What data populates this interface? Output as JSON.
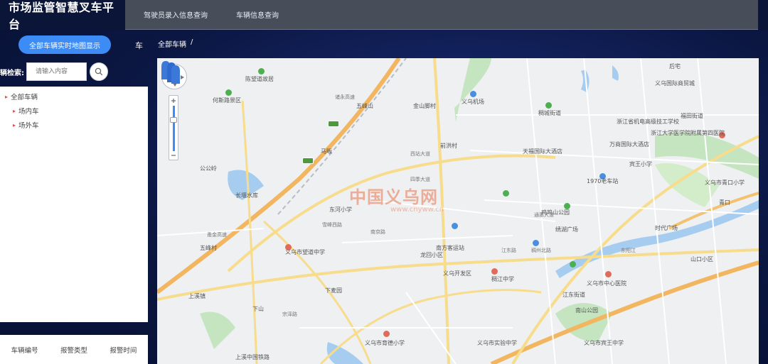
{
  "app": {
    "title": "市场监管智慧叉车平台"
  },
  "nav": {
    "items": [
      "驾驶员录入信息查询",
      "车辆信息查询"
    ]
  },
  "left": {
    "realtime_button": "全部车辆实时地图显示",
    "car_label": "车",
    "search": {
      "label": "辆检索:",
      "placeholder": "请输入内容"
    },
    "tree": {
      "root": "全部车辆",
      "children": [
        "场内车",
        "场外车"
      ]
    },
    "table_headers": [
      "车辆编号",
      "报警类型",
      "报警时间"
    ]
  },
  "breadcrumb": [
    "全部车辆",
    "/"
  ],
  "map": {
    "watermark": "中国义乌网",
    "watermark_url": "www.cnyww.cn",
    "places": [
      {
        "name": "义乌机场"
      },
      {
        "name": "稠城街道"
      },
      {
        "name": "江东街道"
      },
      {
        "name": "福田街道"
      },
      {
        "name": "南方客运站"
      },
      {
        "name": "义乌开发区"
      },
      {
        "name": "稠江中学"
      },
      {
        "name": "义乌市中心医院"
      },
      {
        "name": "宾王小学"
      },
      {
        "name": "何斯路景区"
      },
      {
        "name": "陈望道故居"
      },
      {
        "name": "五峰山"
      },
      {
        "name": "金山脚村"
      },
      {
        "name": "前洪村"
      },
      {
        "name": "马畈"
      },
      {
        "name": "公公岭"
      },
      {
        "name": "长堰水库"
      },
      {
        "name": "东河小学"
      },
      {
        "name": "五峰村"
      },
      {
        "name": "义乌市望道中学"
      },
      {
        "name": "龙回小区"
      },
      {
        "name": "下麦园"
      },
      {
        "name": "上溪镇"
      },
      {
        "name": "下山"
      },
      {
        "name": "义乌市育德小学"
      },
      {
        "name": "义乌市实验中学"
      },
      {
        "name": "义乌市宾王中学"
      },
      {
        "name": "1970老车站"
      },
      {
        "name": "天福国际大酒店"
      },
      {
        "name": "万商国际大酒店"
      },
      {
        "name": "浙江省机电高级技工学校"
      },
      {
        "name": "浙江大学医学院附属第四医院"
      },
      {
        "name": "上溪中国铁路"
      },
      {
        "name": "时代广场"
      },
      {
        "name": "南山公园"
      },
      {
        "name": "山口小区"
      },
      {
        "name": "鸡鸣山公园"
      },
      {
        "name": "绣湖广场"
      },
      {
        "name": "后宅"
      },
      {
        "name": "青口"
      },
      {
        "name": "义乌国际商贸城"
      },
      {
        "name": "义乌市青口小学"
      }
    ],
    "roads": [
      {
        "name": "西站大道"
      },
      {
        "name": "四季大道"
      },
      {
        "name": "雪峰西路"
      },
      {
        "name": "南京路"
      },
      {
        "name": "稠州北路"
      },
      {
        "name": "江东路"
      },
      {
        "name": "东阳江"
      },
      {
        "name": "通惠大道"
      },
      {
        "name": "甬金高速"
      },
      {
        "name": "诸永高速"
      },
      {
        "name": "宗泽路"
      }
    ]
  }
}
